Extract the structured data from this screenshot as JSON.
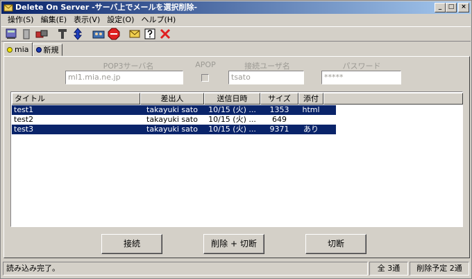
{
  "window": {
    "title": "Delete On Server  -サーバ上でメールを選択削除-"
  },
  "title_buttons": {
    "minimize": "_",
    "maximize": "□",
    "close": "×"
  },
  "menu": [
    "操作(S)",
    "編集(E)",
    "表示(V)",
    "設定(O)",
    "ヘルプ(H)"
  ],
  "toolbar_icons": [
    "server-icon",
    "trash-icon",
    "delete-icon",
    "text-icon",
    "sort-icon",
    "account-icon",
    "stop-icon",
    "mail-icon",
    "help-icon",
    "close-x-icon"
  ],
  "tabs": [
    {
      "label": "mia",
      "color": "#f0e000"
    },
    {
      "label": "新規",
      "color": "#1a3cb0"
    }
  ],
  "fields": {
    "pop3_label": "POP3サーバ名",
    "pop3_value": "ml1.mia.ne.jp",
    "apop_label": "APOP",
    "user_label": "接続ユーザ名",
    "user_value": "tsato",
    "password_label": "パスワード",
    "password_value": "*****"
  },
  "list": {
    "columns": [
      "タイトル",
      "差出人",
      "送信日時",
      "サイズ",
      "添付"
    ],
    "rows": [
      {
        "title": "test1",
        "from": "takayuki sato",
        "date": "10/15 (火) ...",
        "size": "1353",
        "attach": "html",
        "selected": true
      },
      {
        "title": "test2",
        "from": "takayuki sato",
        "date": "10/15 (火) ...",
        "size": "649",
        "attach": "",
        "selected": false
      },
      {
        "title": "test3",
        "from": "takayuki sato",
        "date": "10/15 (火) ...",
        "size": "9371",
        "attach": "あり",
        "selected": true
      }
    ]
  },
  "buttons": {
    "connect": "接続",
    "delete_disconnect": "削除 + 切断",
    "disconnect": "切断"
  },
  "status": {
    "message": "読み込み完了。",
    "total": "全 3通",
    "to_delete": "削除予定 2通"
  }
}
